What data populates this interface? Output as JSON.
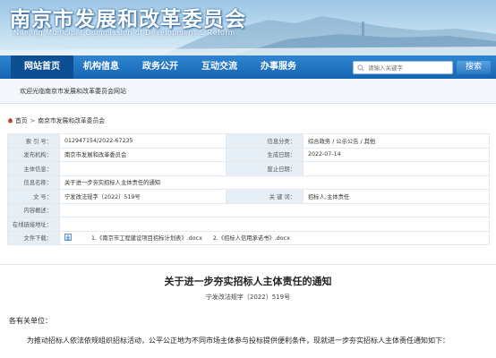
{
  "header": {
    "title": "南京市发展和改革委员会",
    "subtitle": "Nanjing Municipal Commission of Development & Reform"
  },
  "nav": {
    "items": [
      {
        "label": "网站首页",
        "active": true
      },
      {
        "label": "机构信息",
        "active": false
      },
      {
        "label": "政务公开",
        "active": false
      },
      {
        "label": "互动交流",
        "active": false
      },
      {
        "label": "办事服务",
        "active": false
      }
    ],
    "search": {
      "placeholder": "请输入关键字",
      "button": "搜索",
      "icon": "search-icon"
    }
  },
  "welcome": "欢迎光临南京市发展和改革委员会网站",
  "breadcrumb": {
    "home": "首页",
    "separator": ">",
    "current": "南京市发展和改革委员会",
    "icon": "home-icon"
  },
  "info": {
    "index_label": "索 引 号：",
    "index_value": "012947154/2022-67235",
    "category_label": "信息分类：",
    "category_value": "综合政务 / 公示公告 / 其他",
    "publisher_label": "发布机构：",
    "publisher_value": "南京市发展和改革委员会",
    "date_label": "生成日期：",
    "date_value": "2022-07-14",
    "topic_label": "主体信息：",
    "topic_value": "",
    "abolish_label": "废止日期：",
    "abolish_value": "",
    "name_label": "信息名称：",
    "name_value": "关于进一步夯实招标人主体责任的通知",
    "docno_label": "文 号：",
    "docno_value": "宁发改法规字〔2022〕519号",
    "keywords_label": "关 键 词：",
    "keywords_value": "招标人;主体责任",
    "summary_label": "内容概述：",
    "summary_value": "",
    "link_label": "在线链接地址：",
    "link_value": "",
    "attach_label": "文件下载：",
    "attachments": [
      "1.《南京市工程建设项目招标计划表》.docx",
      "2.《招标人信用承诺书》.docx"
    ]
  },
  "article": {
    "title": "关于进一步夯实招标人主体责任的通知",
    "doc_no": "宁发改法规字〔2022〕519号",
    "addressee": "各有关单位：",
    "para1": "为推动招标人依法依规组织招标活动，公平公正地为不同市场主体参与投标提供便利条件，现就进一步夯实招标人主体责任通知如下："
  },
  "colors": {
    "nav": "#1664b3",
    "nav_active": "#0e4f93",
    "label_bg": "#e6eef6",
    "banner": "#bfdcf0"
  }
}
